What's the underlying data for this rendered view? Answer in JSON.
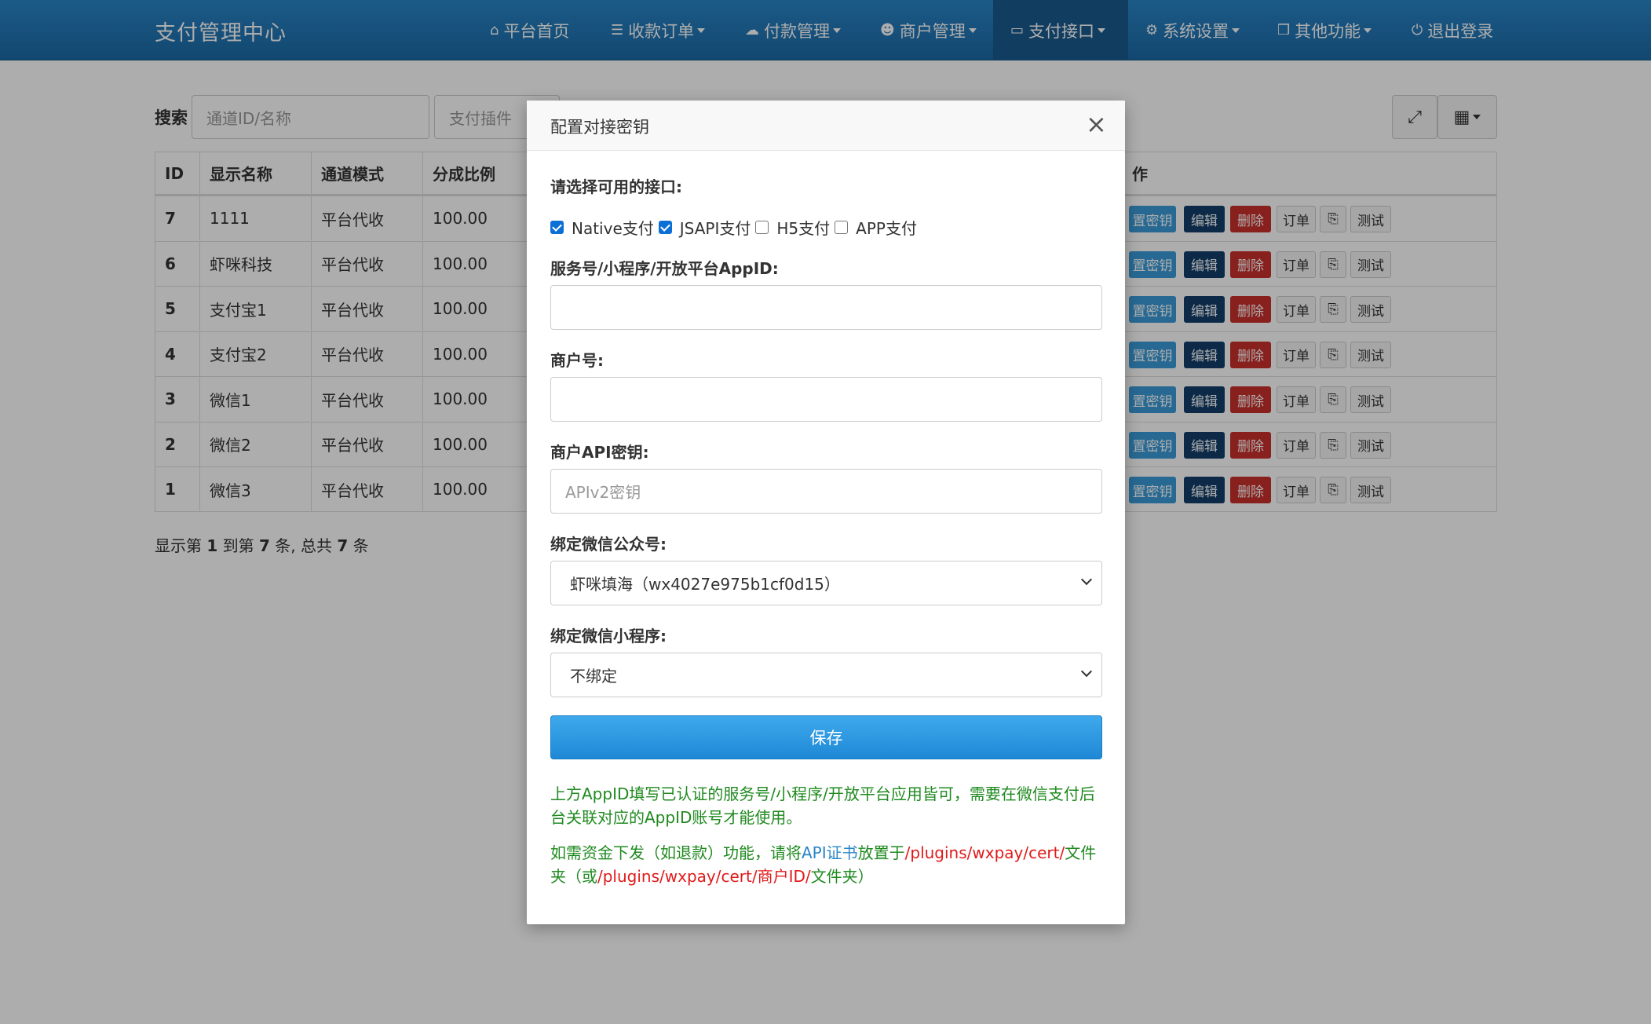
{
  "navbar": {
    "brand": "支付管理中心",
    "items": [
      {
        "label": "平台首页",
        "icon": "home-icon"
      },
      {
        "label": "收款订单",
        "icon": "list-icon"
      },
      {
        "label": "付款管理",
        "icon": "cloud-icon"
      },
      {
        "label": "商户管理",
        "icon": "user-icon"
      },
      {
        "label": "支付接口",
        "icon": "credit-card-icon"
      },
      {
        "label": "系统设置",
        "icon": "gear-icon"
      },
      {
        "label": "其他功能",
        "icon": "cube-icon"
      },
      {
        "label": "退出登录",
        "icon": "power-icon"
      }
    ]
  },
  "search": {
    "label": "搜索",
    "channel_placeholder": "通道ID/名称",
    "plugin_placeholder": "支付插件"
  },
  "table": {
    "headers": [
      "ID",
      "显示名称",
      "通道模式",
      "分成比例",
      "作"
    ],
    "rows": [
      {
        "id": "7",
        "name": "1111",
        "mode": "平台代收",
        "ratio": "100.00"
      },
      {
        "id": "6",
        "name": "虾咪科技",
        "mode": "平台代收",
        "ratio": "100.00"
      },
      {
        "id": "5",
        "name": "支付宝1",
        "mode": "平台代收",
        "ratio": "100.00"
      },
      {
        "id": "4",
        "name": "支付宝2",
        "mode": "平台代收",
        "ratio": "100.00"
      },
      {
        "id": "3",
        "name": "微信1",
        "mode": "平台代收",
        "ratio": "100.00"
      },
      {
        "id": "2",
        "name": "微信2",
        "mode": "平台代收",
        "ratio": "100.00"
      },
      {
        "id": "1",
        "name": "微信3",
        "mode": "平台代收",
        "ratio": "100.00"
      }
    ],
    "actions": {
      "config": "置密钥",
      "edit": "编辑",
      "delete": "删除",
      "orders": "订单",
      "test": "测试"
    },
    "summary": {
      "prefix": "显示第",
      "from": "1",
      "mid": "到第",
      "to": "7",
      "mid2": "条, 总共",
      "total": "7",
      "suffix": "条"
    }
  },
  "modal": {
    "title": "配置对接密钥",
    "interfaces_label": "请选择可用的接口:",
    "checkboxes": [
      {
        "label": "Native支付",
        "checked": true
      },
      {
        "label": "JSAPI支付",
        "checked": true
      },
      {
        "label": "H5支付",
        "checked": false
      },
      {
        "label": "APP支付",
        "checked": false
      }
    ],
    "appid_label": "服务号/小程序/开放平台AppID:",
    "appid_value": "",
    "mchid_label": "商户号:",
    "mchid_value": "",
    "apikey_label": "商户API密钥:",
    "apikey_placeholder": "APIv2密钥",
    "mp_label": "绑定微信公众号:",
    "mp_selected": "虾咪填海（wx4027e975b1cf0d15）",
    "mini_label": "绑定微信小程序:",
    "mini_selected": "不绑定",
    "save_label": "保存",
    "note1": "上方AppID填写已认证的服务号/小程序/开放平台应用皆可，需要在微信支付后台关联对应的AppID账号才能使用。",
    "note2_a": "如需资金下发（如退款）功能，请将",
    "note2_link": "API证书",
    "note2_b": "放置于",
    "note2_path1": "/plugins/wxpay/cert/",
    "note2_c": "文件夹（或",
    "note2_path2": "/plugins/wxpay/cert/商户ID/",
    "note2_d": "文件夹）"
  }
}
